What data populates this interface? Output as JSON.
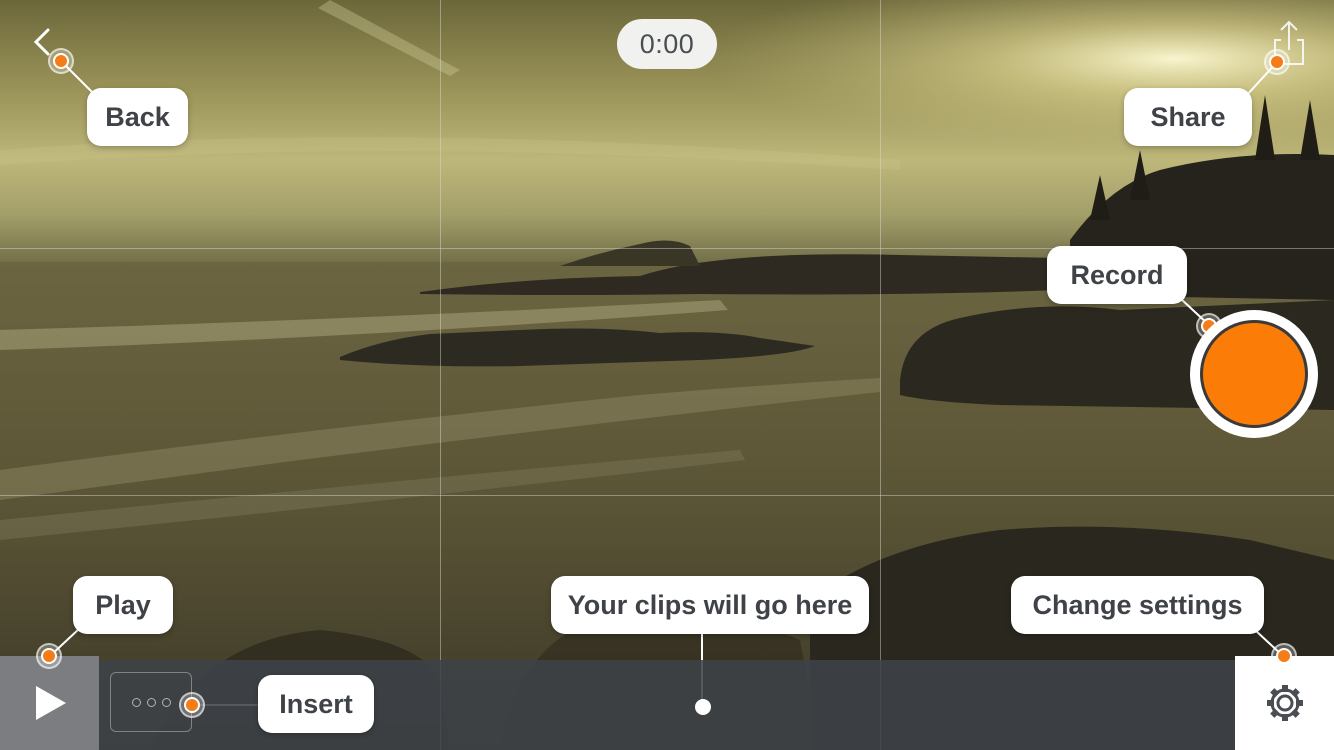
{
  "timer": "0:00",
  "tooltips": {
    "back": "Back",
    "share": "Share",
    "record": "Record",
    "play": "Play",
    "clips": "Your clips will go here",
    "settings": "Change settings",
    "insert": "Insert"
  },
  "icons": {
    "back": "chevron-left-icon",
    "share": "share-icon",
    "play": "play-icon",
    "settings": "gear-icon",
    "record": "record-icon"
  },
  "colors": {
    "accent": "#fb7d08",
    "hint_dot": "#f47d1a",
    "bar": "#3e4248",
    "play_button": "#7b7d80"
  }
}
